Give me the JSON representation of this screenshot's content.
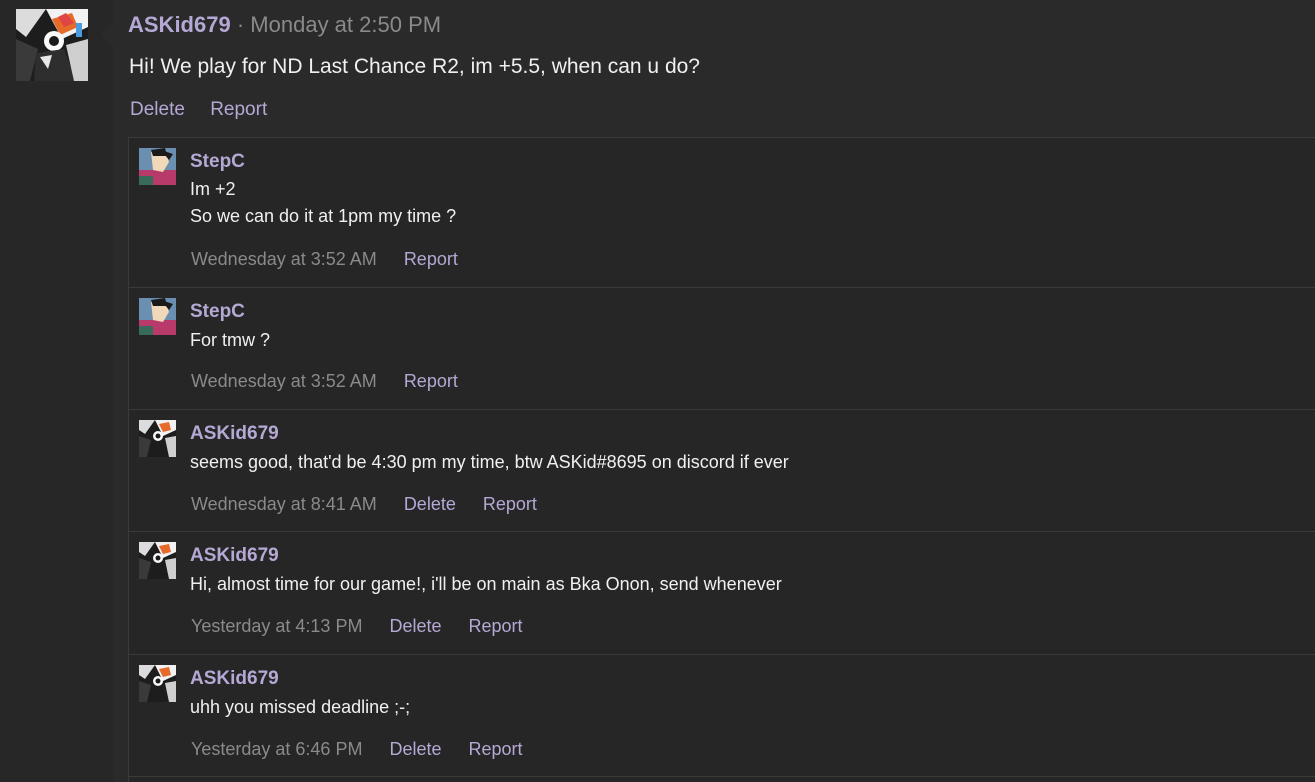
{
  "main_post": {
    "username": "ASKid679",
    "separator": "·",
    "timestamp": "Monday at 2:50 PM",
    "body": "Hi! We play for ND Last Chance R2, im +5.5, when can u do?",
    "actions": {
      "delete": "Delete",
      "report": "Report"
    }
  },
  "comments": [
    {
      "username": "StepC",
      "lines": [
        "Im +2",
        "So we can do it at 1pm my time ?"
      ],
      "timestamp": "Wednesday at 3:52 AM",
      "report": "Report"
    },
    {
      "username": "StepC",
      "lines": [
        "For tmw ?"
      ],
      "timestamp": "Wednesday at 3:52 AM",
      "report": "Report"
    },
    {
      "username": "ASKid679",
      "lines": [
        "seems good, that'd be 4:30 pm my time, btw ASKid#8695 on discord if ever"
      ],
      "timestamp": "Wednesday at 8:41 AM",
      "delete": "Delete",
      "report": "Report"
    },
    {
      "username": "ASKid679",
      "lines": [
        "Hi, almost time for our game!, i'll be on main as Bka Onon, send whenever"
      ],
      "timestamp": "Yesterday at 4:13 PM",
      "delete": "Delete",
      "report": "Report"
    },
    {
      "username": "ASKid679",
      "lines": [
        "uhh you missed deadline ;-;"
      ],
      "timestamp": "Yesterday at 6:46 PM",
      "delete": "Delete",
      "report": "Report"
    }
  ],
  "colors": {
    "accent": "#b5a8d4",
    "muted": "#8a8a8a",
    "background": "#242424"
  },
  "icons": {
    "main_avatar": "askid679-avatar",
    "stepc_avatar": "stepc-avatar"
  }
}
